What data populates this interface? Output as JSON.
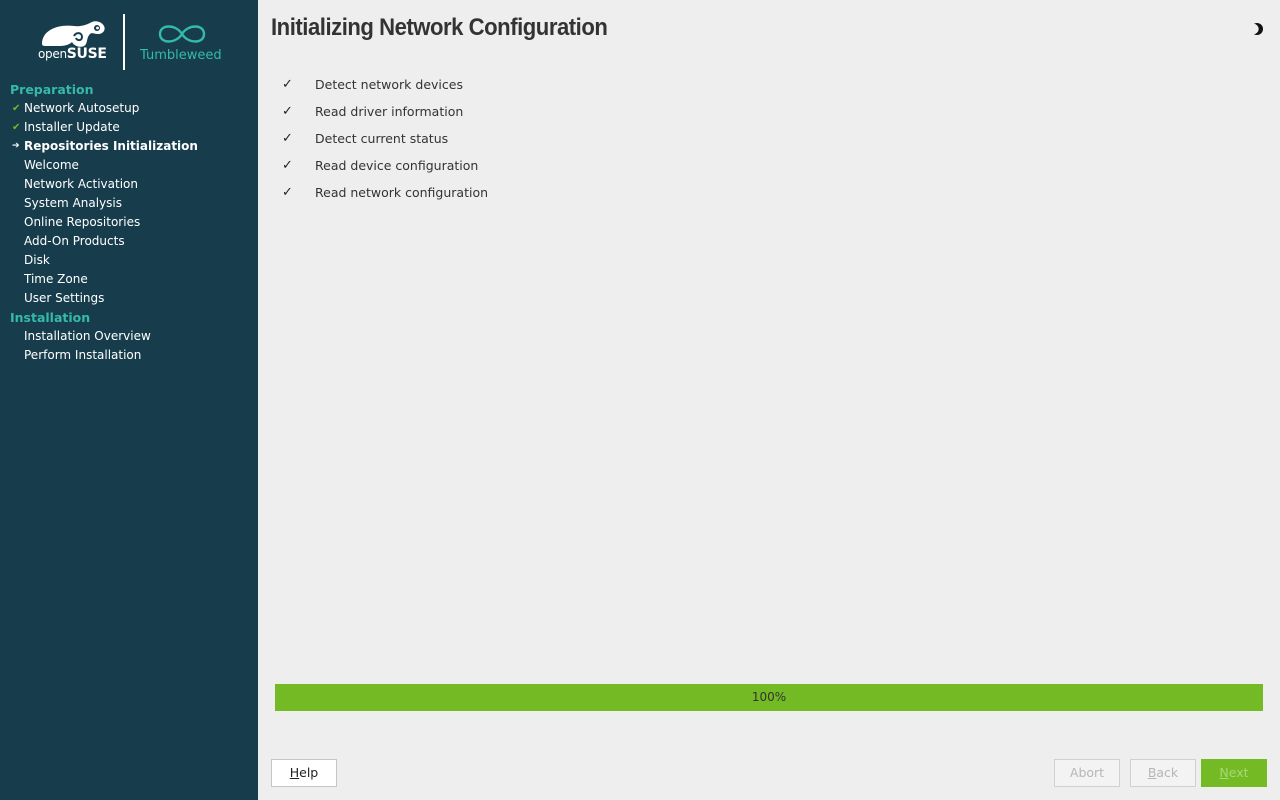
{
  "brand": {
    "opensuse_prefix": "open",
    "opensuse_suffix": "SUSE",
    "product": "Tumbleweed",
    "accent_color": "#35b9ab",
    "green_color": "#73ba25",
    "sidebar_color": "#173d4d"
  },
  "sidebar": {
    "steps": [
      {
        "label": "Preparation",
        "kind": "section",
        "status": ""
      },
      {
        "label": "Network Autosetup",
        "kind": "step",
        "status": "done"
      },
      {
        "label": "Installer Update",
        "kind": "step",
        "status": "done"
      },
      {
        "label": "Repositories Initialization",
        "kind": "step",
        "status": "current"
      },
      {
        "label": "Welcome",
        "kind": "step",
        "status": ""
      },
      {
        "label": "Network Activation",
        "kind": "step",
        "status": ""
      },
      {
        "label": "System Analysis",
        "kind": "step",
        "status": ""
      },
      {
        "label": "Online Repositories",
        "kind": "step",
        "status": ""
      },
      {
        "label": "Add-On Products",
        "kind": "step",
        "status": ""
      },
      {
        "label": "Disk",
        "kind": "step",
        "status": ""
      },
      {
        "label": "Time Zone",
        "kind": "step",
        "status": ""
      },
      {
        "label": "User Settings",
        "kind": "step",
        "status": ""
      },
      {
        "label": "Installation",
        "kind": "section",
        "status": ""
      },
      {
        "label": "Installation Overview",
        "kind": "step",
        "status": ""
      },
      {
        "label": "Perform Installation",
        "kind": "step",
        "status": ""
      }
    ]
  },
  "main": {
    "title": "Initializing Network Configuration",
    "theme_icon": "half-moon-icon",
    "tasks": [
      {
        "check": "✓",
        "label": "Detect network devices"
      },
      {
        "check": "✓",
        "label": "Read driver information"
      },
      {
        "check": "✓",
        "label": "Detect current status"
      },
      {
        "check": "✓",
        "label": "Read device configuration"
      },
      {
        "check": "✓",
        "label": "Read network configuration"
      }
    ],
    "progress": {
      "value": 100,
      "label": "100%"
    }
  },
  "buttons": {
    "help": {
      "first": "H",
      "rest": "elp",
      "enabled": true
    },
    "abort": {
      "first": "",
      "rest": "Abort",
      "enabled": false
    },
    "back": {
      "first": "B",
      "rest": "ack",
      "enabled": false
    },
    "next": {
      "first": "N",
      "rest": "ext",
      "enabled": false
    }
  }
}
